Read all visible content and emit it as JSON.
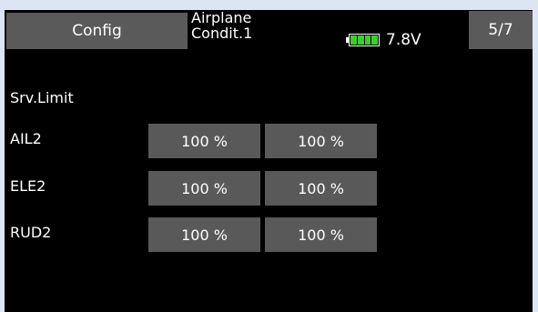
{
  "header": {
    "config_label": "Config",
    "model_type": "Airplane",
    "condition": "Condit.1",
    "voltage": "7.8V",
    "page": "5/7",
    "battery_cells": 4,
    "battery_color": "#3bd12a"
  },
  "section_title": "Srv.Limit",
  "rows": [
    {
      "label": "AIL2",
      "values": [
        "100 %",
        "100 %"
      ]
    },
    {
      "label": "ELE2",
      "values": [
        "100 %",
        "100 %"
      ]
    },
    {
      "label": "RUD2",
      "values": [
        "100 %",
        "100 %"
      ]
    }
  ]
}
